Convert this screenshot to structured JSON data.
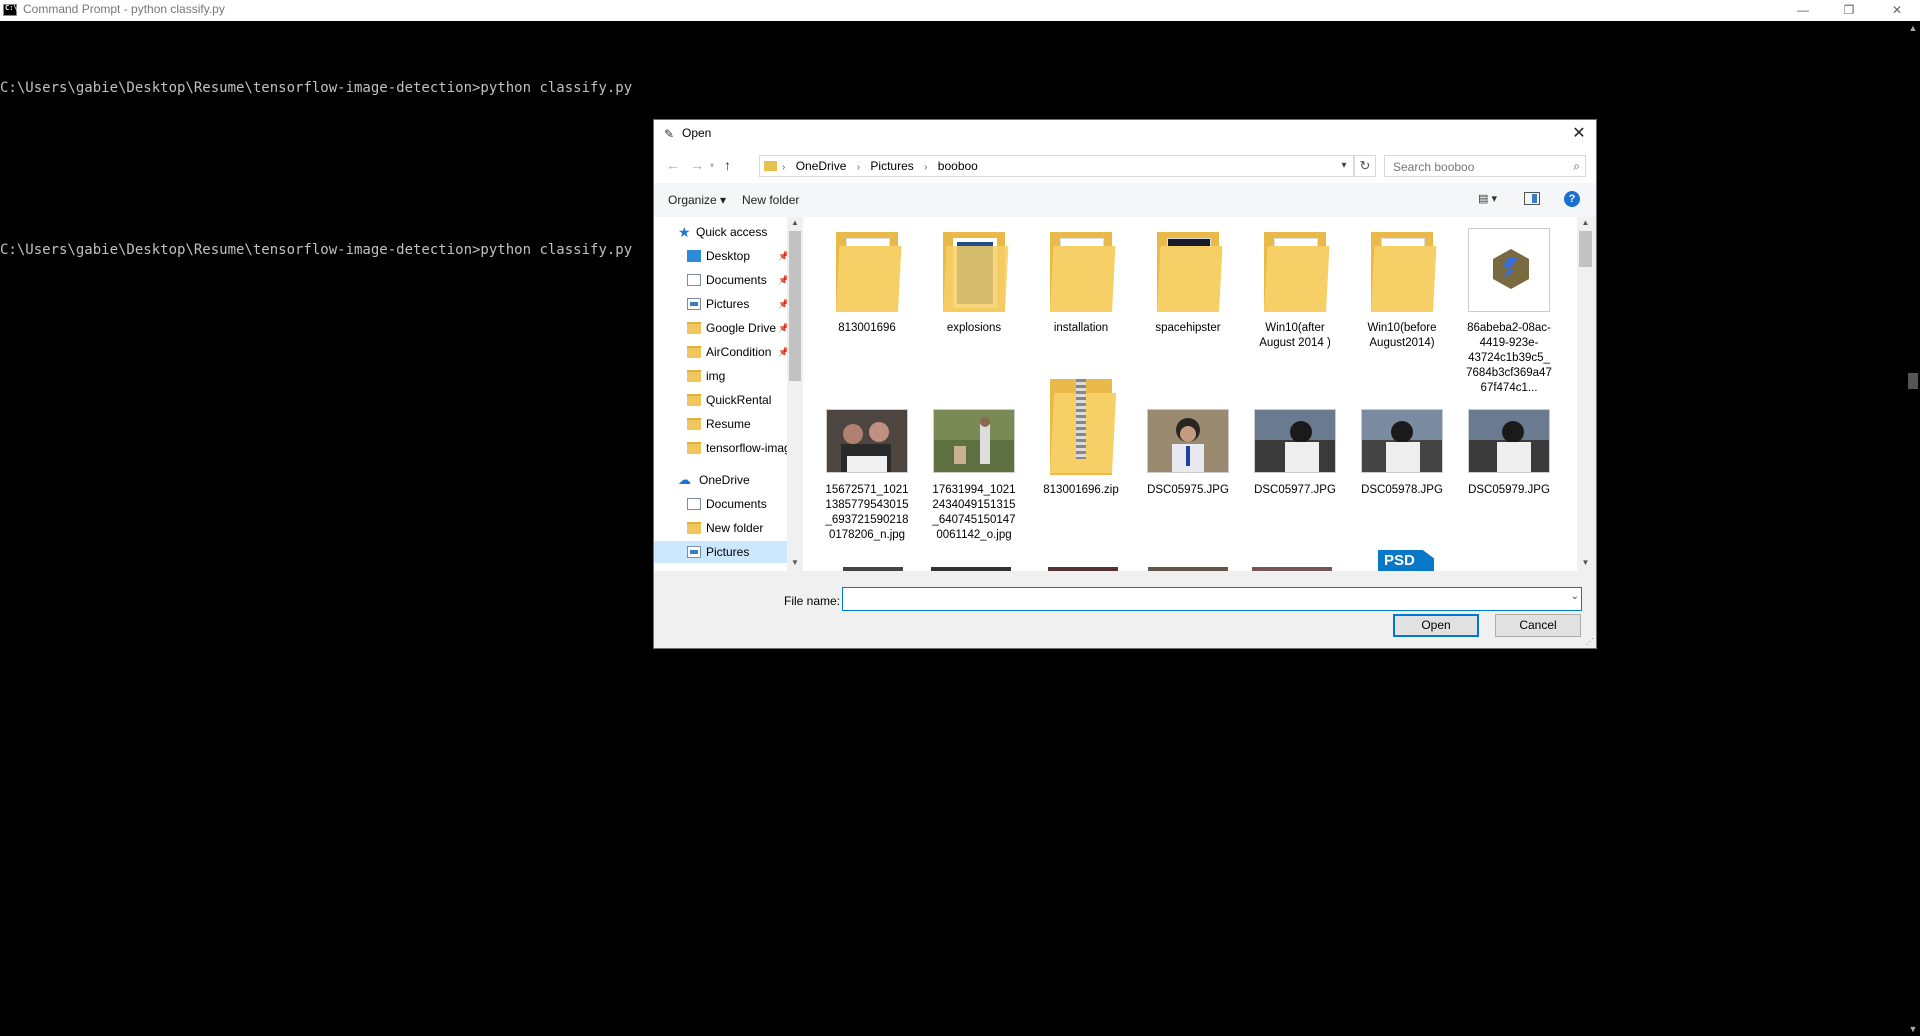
{
  "window": {
    "title": "Command Prompt - python  classify.py",
    "controls": {
      "minimize": "—",
      "maximize": "❐",
      "close": "✕"
    }
  },
  "console": {
    "lines": [
      "C:\\Users\\gabie\\Desktop\\Resume\\tensorflow-image-detection>python classify.py",
      "",
      "C:\\Users\\gabie\\Desktop\\Resume\\tensorflow-image-detection>python classify.py"
    ]
  },
  "dialog": {
    "title": "Open",
    "close": "✕",
    "address": {
      "crumbs": [
        "OneDrive",
        "Pictures",
        "booboo"
      ]
    },
    "search": {
      "placeholder": "Search booboo"
    },
    "toolbar": {
      "organize": "Organize ▾",
      "new_folder": "New folder",
      "help": "?"
    },
    "nav": {
      "quick_access": "Quick access",
      "items": [
        {
          "label": "Desktop",
          "icon": "desktop-icon",
          "pinned": true
        },
        {
          "label": "Documents",
          "icon": "documents-icon",
          "pinned": true
        },
        {
          "label": "Pictures",
          "icon": "pictures-icon",
          "pinned": true
        },
        {
          "label": "Google Drive",
          "icon": "folder-icon",
          "pinned": true
        },
        {
          "label": "AirCondition",
          "icon": "folder-icon",
          "pinned": true
        },
        {
          "label": "img",
          "icon": "folder-icon",
          "pinned": false
        },
        {
          "label": "QuickRental",
          "icon": "folder-icon",
          "pinned": false
        },
        {
          "label": "Resume",
          "icon": "folder-icon",
          "pinned": false
        },
        {
          "label": "tensorflow-imag",
          "icon": "folder-icon",
          "pinned": false
        }
      ],
      "onedrive": "OneDrive",
      "onedrive_items": [
        {
          "label": "Documents",
          "icon": "documents-icon"
        },
        {
          "label": "New folder",
          "icon": "folder-icon"
        },
        {
          "label": "Pictures",
          "icon": "pictures-icon",
          "selected": true
        }
      ]
    },
    "files_row1": [
      {
        "name": "813001696",
        "kind": "folder"
      },
      {
        "name": "explosions",
        "kind": "folder"
      },
      {
        "name": "installation",
        "kind": "folder"
      },
      {
        "name": "spacehipster",
        "kind": "folder"
      },
      {
        "name": "Win10(after August 2014 )",
        "kind": "folder"
      },
      {
        "name": "Win10(before August2014)",
        "kind": "folder"
      },
      {
        "name": "86abeba2-08ac-4419-923e-43724c1b39c5_7684b3cf369a4767f474c1...",
        "kind": "app"
      }
    ],
    "files_row2": [
      {
        "name": "15672571_10211385779543015_6937215902180178206_n.jpg",
        "kind": "photo",
        "color": "#6a5a50"
      },
      {
        "name": "17631994_10212434049151315_6407451501470061142_o.jpg",
        "kind": "photo",
        "color": "#6b7a4a"
      },
      {
        "name": "813001696.zip",
        "kind": "zip"
      },
      {
        "name": "DSC05975.JPG",
        "kind": "photo",
        "color": "#8a7a6a"
      },
      {
        "name": "DSC05977.JPG",
        "kind": "photo",
        "color": "#5a6a7a"
      },
      {
        "name": "DSC05978.JPG",
        "kind": "photo",
        "color": "#5a6a7a"
      },
      {
        "name": "DSC05979.JPG",
        "kind": "photo",
        "color": "#5a6a7a"
      }
    ],
    "partial_row_label": "PSD",
    "filename": {
      "label": "File name:",
      "value": ""
    },
    "buttons": {
      "open": "Open",
      "cancel": "Cancel"
    }
  }
}
